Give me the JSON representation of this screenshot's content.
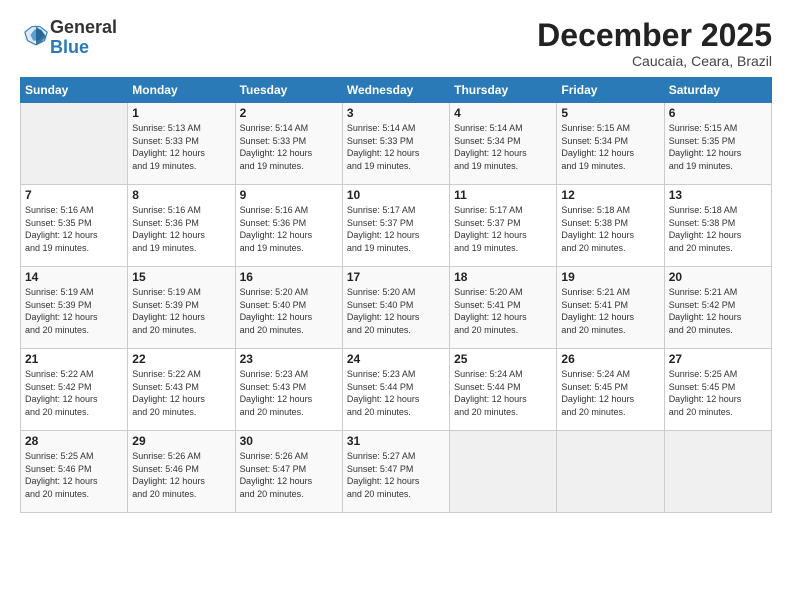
{
  "header": {
    "logo_general": "General",
    "logo_blue": "Blue",
    "month": "December 2025",
    "location": "Caucaia, Ceara, Brazil"
  },
  "days_of_week": [
    "Sunday",
    "Monday",
    "Tuesday",
    "Wednesday",
    "Thursday",
    "Friday",
    "Saturday"
  ],
  "weeks": [
    [
      {
        "day": "",
        "info": ""
      },
      {
        "day": "1",
        "info": "Sunrise: 5:13 AM\nSunset: 5:33 PM\nDaylight: 12 hours\nand 19 minutes."
      },
      {
        "day": "2",
        "info": "Sunrise: 5:14 AM\nSunset: 5:33 PM\nDaylight: 12 hours\nand 19 minutes."
      },
      {
        "day": "3",
        "info": "Sunrise: 5:14 AM\nSunset: 5:33 PM\nDaylight: 12 hours\nand 19 minutes."
      },
      {
        "day": "4",
        "info": "Sunrise: 5:14 AM\nSunset: 5:34 PM\nDaylight: 12 hours\nand 19 minutes."
      },
      {
        "day": "5",
        "info": "Sunrise: 5:15 AM\nSunset: 5:34 PM\nDaylight: 12 hours\nand 19 minutes."
      },
      {
        "day": "6",
        "info": "Sunrise: 5:15 AM\nSunset: 5:35 PM\nDaylight: 12 hours\nand 19 minutes."
      }
    ],
    [
      {
        "day": "7",
        "info": "Sunrise: 5:16 AM\nSunset: 5:35 PM\nDaylight: 12 hours\nand 19 minutes."
      },
      {
        "day": "8",
        "info": "Sunrise: 5:16 AM\nSunset: 5:36 PM\nDaylight: 12 hours\nand 19 minutes."
      },
      {
        "day": "9",
        "info": "Sunrise: 5:16 AM\nSunset: 5:36 PM\nDaylight: 12 hours\nand 19 minutes."
      },
      {
        "day": "10",
        "info": "Sunrise: 5:17 AM\nSunset: 5:37 PM\nDaylight: 12 hours\nand 19 minutes."
      },
      {
        "day": "11",
        "info": "Sunrise: 5:17 AM\nSunset: 5:37 PM\nDaylight: 12 hours\nand 19 minutes."
      },
      {
        "day": "12",
        "info": "Sunrise: 5:18 AM\nSunset: 5:38 PM\nDaylight: 12 hours\nand 20 minutes."
      },
      {
        "day": "13",
        "info": "Sunrise: 5:18 AM\nSunset: 5:38 PM\nDaylight: 12 hours\nand 20 minutes."
      }
    ],
    [
      {
        "day": "14",
        "info": "Sunrise: 5:19 AM\nSunset: 5:39 PM\nDaylight: 12 hours\nand 20 minutes."
      },
      {
        "day": "15",
        "info": "Sunrise: 5:19 AM\nSunset: 5:39 PM\nDaylight: 12 hours\nand 20 minutes."
      },
      {
        "day": "16",
        "info": "Sunrise: 5:20 AM\nSunset: 5:40 PM\nDaylight: 12 hours\nand 20 minutes."
      },
      {
        "day": "17",
        "info": "Sunrise: 5:20 AM\nSunset: 5:40 PM\nDaylight: 12 hours\nand 20 minutes."
      },
      {
        "day": "18",
        "info": "Sunrise: 5:20 AM\nSunset: 5:41 PM\nDaylight: 12 hours\nand 20 minutes."
      },
      {
        "day": "19",
        "info": "Sunrise: 5:21 AM\nSunset: 5:41 PM\nDaylight: 12 hours\nand 20 minutes."
      },
      {
        "day": "20",
        "info": "Sunrise: 5:21 AM\nSunset: 5:42 PM\nDaylight: 12 hours\nand 20 minutes."
      }
    ],
    [
      {
        "day": "21",
        "info": "Sunrise: 5:22 AM\nSunset: 5:42 PM\nDaylight: 12 hours\nand 20 minutes."
      },
      {
        "day": "22",
        "info": "Sunrise: 5:22 AM\nSunset: 5:43 PM\nDaylight: 12 hours\nand 20 minutes."
      },
      {
        "day": "23",
        "info": "Sunrise: 5:23 AM\nSunset: 5:43 PM\nDaylight: 12 hours\nand 20 minutes."
      },
      {
        "day": "24",
        "info": "Sunrise: 5:23 AM\nSunset: 5:44 PM\nDaylight: 12 hours\nand 20 minutes."
      },
      {
        "day": "25",
        "info": "Sunrise: 5:24 AM\nSunset: 5:44 PM\nDaylight: 12 hours\nand 20 minutes."
      },
      {
        "day": "26",
        "info": "Sunrise: 5:24 AM\nSunset: 5:45 PM\nDaylight: 12 hours\nand 20 minutes."
      },
      {
        "day": "27",
        "info": "Sunrise: 5:25 AM\nSunset: 5:45 PM\nDaylight: 12 hours\nand 20 minutes."
      }
    ],
    [
      {
        "day": "28",
        "info": "Sunrise: 5:25 AM\nSunset: 5:46 PM\nDaylight: 12 hours\nand 20 minutes."
      },
      {
        "day": "29",
        "info": "Sunrise: 5:26 AM\nSunset: 5:46 PM\nDaylight: 12 hours\nand 20 minutes."
      },
      {
        "day": "30",
        "info": "Sunrise: 5:26 AM\nSunset: 5:47 PM\nDaylight: 12 hours\nand 20 minutes."
      },
      {
        "day": "31",
        "info": "Sunrise: 5:27 AM\nSunset: 5:47 PM\nDaylight: 12 hours\nand 20 minutes."
      },
      {
        "day": "",
        "info": ""
      },
      {
        "day": "",
        "info": ""
      },
      {
        "day": "",
        "info": ""
      }
    ]
  ]
}
